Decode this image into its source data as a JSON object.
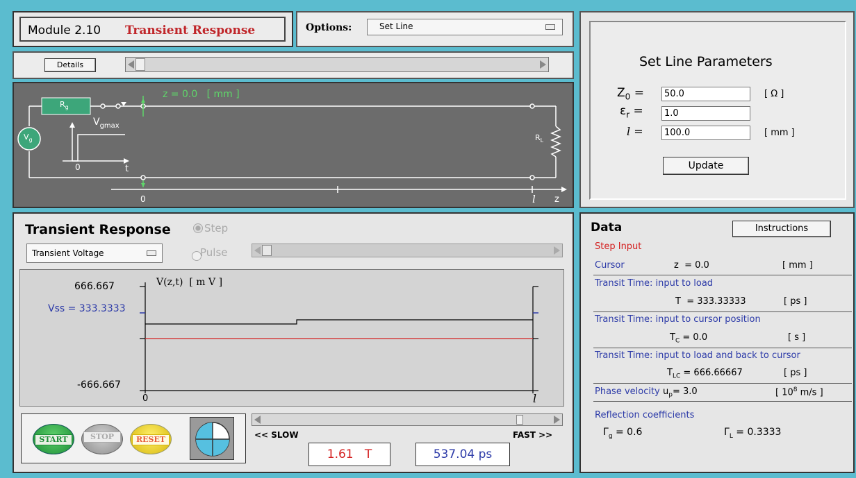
{
  "header": {
    "module": "Module 2.10",
    "title": "Transient Response"
  },
  "options": {
    "label": "Options:",
    "selected": "Set Line"
  },
  "details_button": "Details",
  "circuit": {
    "rg": "R",
    "rg_sub": "g",
    "vg": "V",
    "vg_sub": "g",
    "vgmax": "V",
    "vgmax_sub": "gmax",
    "rl": "R",
    "rl_sub": "L",
    "zero_origin": "0",
    "t_axis": "t",
    "cursor_readout": "z = 0.0   [ mm ]",
    "z_zero": "0",
    "l_label": "l",
    "z_axis": "z"
  },
  "set_line": {
    "title": "Set Line Parameters",
    "z0_label": "Z",
    "z0_sub": "0",
    "z0_value": "50.0",
    "z0_unit": "[ Ω ]",
    "er_label": "ε",
    "er_sub": "r",
    "er_value": "1.0",
    "l_label": "l =",
    "l_value": "100.0",
    "l_unit": "[ mm ]",
    "update_button": "Update"
  },
  "transient": {
    "title": "Transient Response",
    "step_label": "Step",
    "pulse_label": "Pulse",
    "dropdown": "Transient Voltage"
  },
  "plot": {
    "ylabel": "V(z,t)  [ m V ]",
    "ymax": "666.667",
    "ymin": "-666.667",
    "vss": "Vss = 333.3333",
    "x0": "0",
    "xl": "l",
    "line_color": "#d42020"
  },
  "controls": {
    "start": "START",
    "stop": "STOP",
    "reset": "RESET",
    "slow": "<< SLOW",
    "fast": "FAST >>",
    "time_T": "1.61   T",
    "time_ps": "537.04 ps"
  },
  "data_panel": {
    "title": "Data",
    "instructions_button": "Instructions",
    "step_input": "Step Input",
    "cursor_label": "Cursor",
    "cursor_value": "z  = 0.0",
    "cursor_unit": "[ mm ]",
    "tt_load_label": "Transit Time: input to load",
    "tt_load_value": "T  = 333.33333",
    "tt_load_unit": "[ ps ]",
    "tt_cursor_label": "Transit Time: input to cursor position",
    "tc_sym": "T",
    "tc_sub": "C",
    "tc_value": "= 0.0",
    "tc_unit": "[ s ]",
    "tt_back_label": "Transit Time: input to load and back to cursor",
    "tlc_sym": "T",
    "tlc_sub": "LC",
    "tlc_value": "= 666.66667",
    "tlc_unit": "[ ps ]",
    "phase_label": "Phase velocity",
    "up_sym": "u",
    "up_sub": "p",
    "up_value": "= 3.0",
    "up_unit_pre": "[ 10",
    "up_unit_sup": "8",
    "up_unit_post": " m/s ]",
    "refl_label": "Reflection coefficients",
    "gg_sym": "Γ",
    "gg_sub": "g",
    "gg_value": "= 0.6",
    "gl_sym": "Γ",
    "gl_sub": "L",
    "gl_value": "= 0.3333"
  }
}
